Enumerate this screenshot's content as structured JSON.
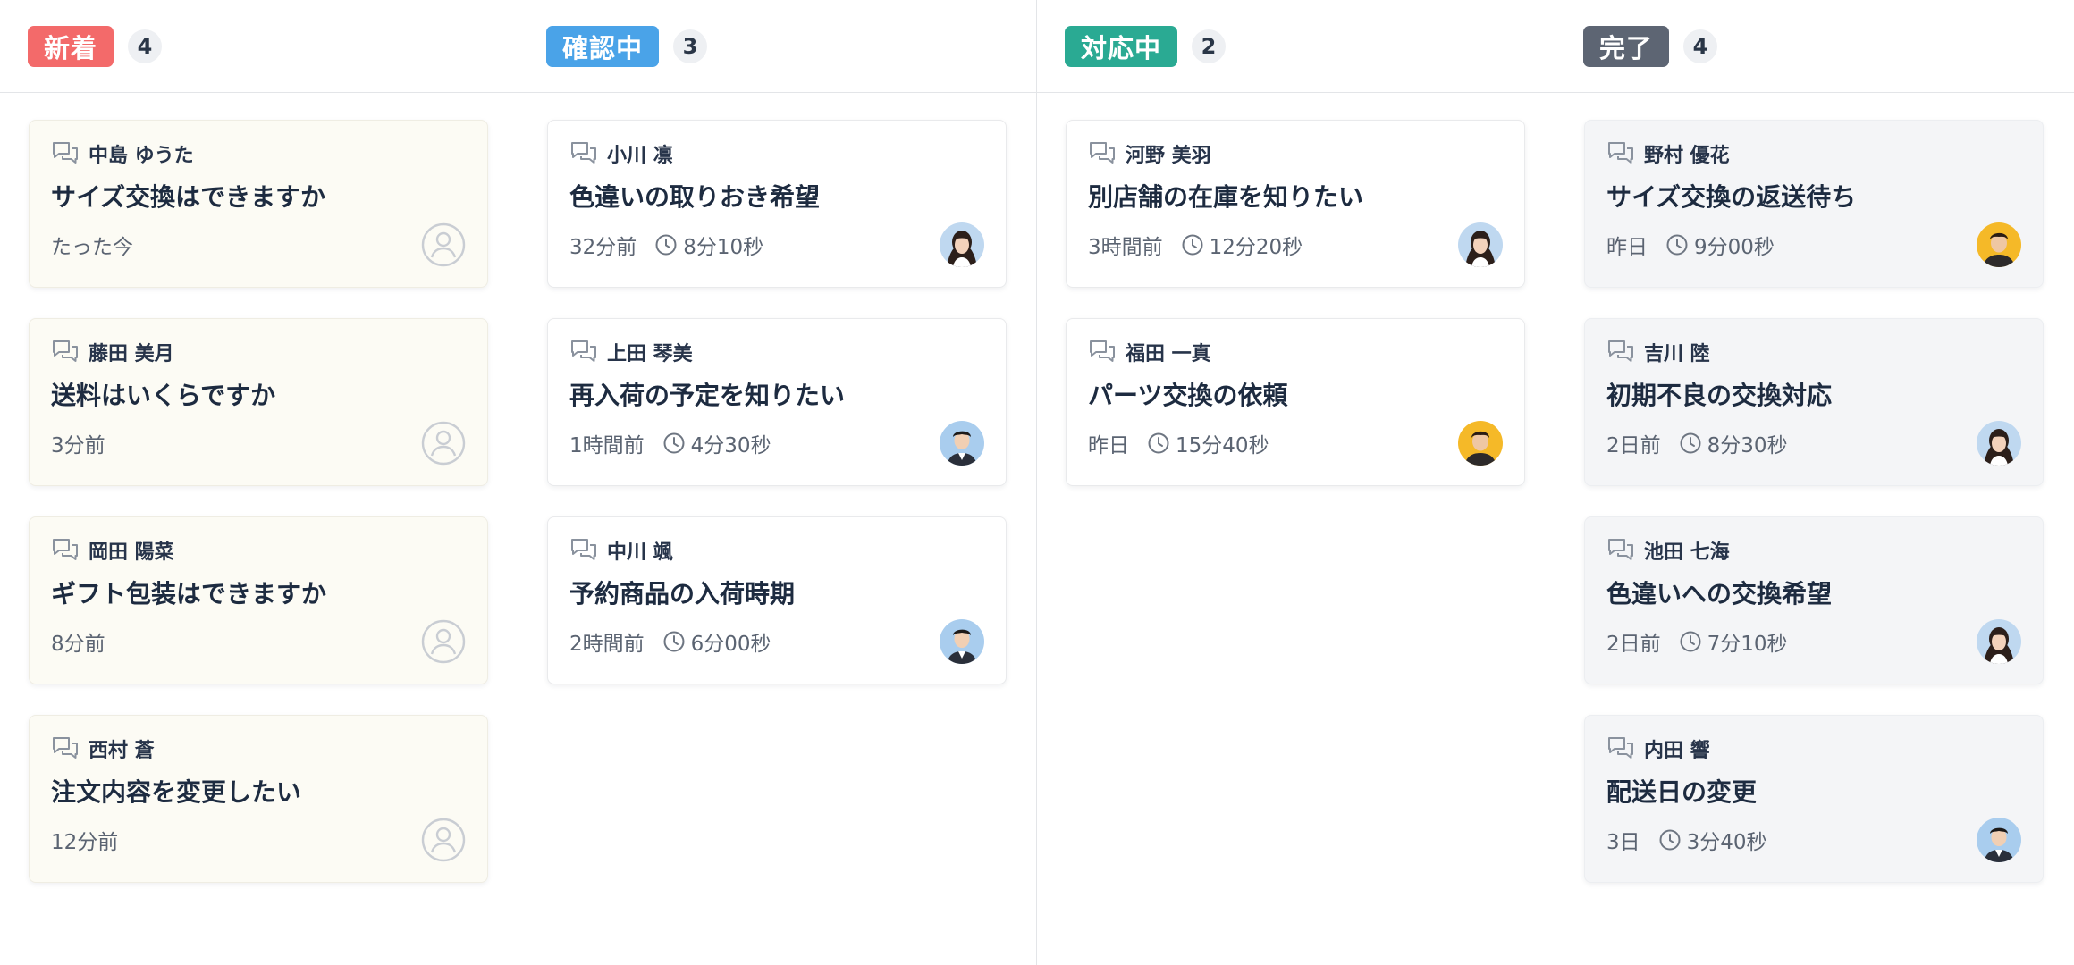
{
  "colors": {
    "new": "#f36a6a",
    "confirm": "#4aa3e8",
    "progress": "#2aaa93",
    "done": "#5d6573"
  },
  "columns": [
    {
      "status": "新着",
      "count": "4",
      "kind": "new",
      "cards": [
        {
          "customer": "中島 ゆうた",
          "subject": "サイズ交換はできますか",
          "time": "たった今",
          "duration": null,
          "avatar": "unassigned-avatar-icon"
        },
        {
          "customer": "藤田 美月",
          "subject": "送料はいくらですか",
          "time": "3分前",
          "duration": null,
          "avatar": "unassigned-avatar-icon"
        },
        {
          "customer": "岡田 陽菜",
          "subject": "ギフト包装はできますか",
          "time": "8分前",
          "duration": null,
          "avatar": "unassigned-avatar-icon"
        },
        {
          "customer": "西村 蒼",
          "subject": "注文内容を変更したい",
          "time": "12分前",
          "duration": null,
          "avatar": "unassigned-avatar-icon"
        }
      ]
    },
    {
      "status": "確認中",
      "count": "3",
      "kind": "confirm",
      "cards": [
        {
          "customer": "小川 凛",
          "subject": "色違いの取りおき希望",
          "time": "32分前",
          "duration": "8分10秒",
          "avatar": "woman"
        },
        {
          "customer": "上田 琴美",
          "subject": "再入荷の予定を知りたい",
          "time": "1時間前",
          "duration": "4分30秒",
          "avatar": "man-suit"
        },
        {
          "customer": "中川 颯",
          "subject": "予約商品の入荷時期",
          "time": "2時間前",
          "duration": "6分00秒",
          "avatar": "man-suit"
        }
      ]
    },
    {
      "status": "対応中",
      "count": "2",
      "kind": "progress",
      "cards": [
        {
          "customer": "河野 美羽",
          "subject": "別店舗の在庫を知りたい",
          "time": "3時間前",
          "duration": "12分20秒",
          "avatar": "woman"
        },
        {
          "customer": "福田 一真",
          "subject": "パーツ交換の依頼",
          "time": "昨日",
          "duration": "15分40秒",
          "avatar": "man-yellow"
        }
      ]
    },
    {
      "status": "完了",
      "count": "4",
      "kind": "done",
      "cards": [
        {
          "customer": "野村 優花",
          "subject": "サイズ交換の返送待ち",
          "time": "昨日",
          "duration": "9分00秒",
          "avatar": "man-yellow"
        },
        {
          "customer": "吉川 陸",
          "subject": "初期不良の交換対応",
          "time": "2日前",
          "duration": "8分30秒",
          "avatar": "woman"
        },
        {
          "customer": "池田 七海",
          "subject": "色違いへの交換希望",
          "time": "2日前",
          "duration": "7分10秒",
          "avatar": "woman"
        },
        {
          "customer": "内田 響",
          "subject": "配送日の変更",
          "time": "3日",
          "duration": "3分40秒",
          "avatar": "man-suit"
        }
      ]
    }
  ]
}
